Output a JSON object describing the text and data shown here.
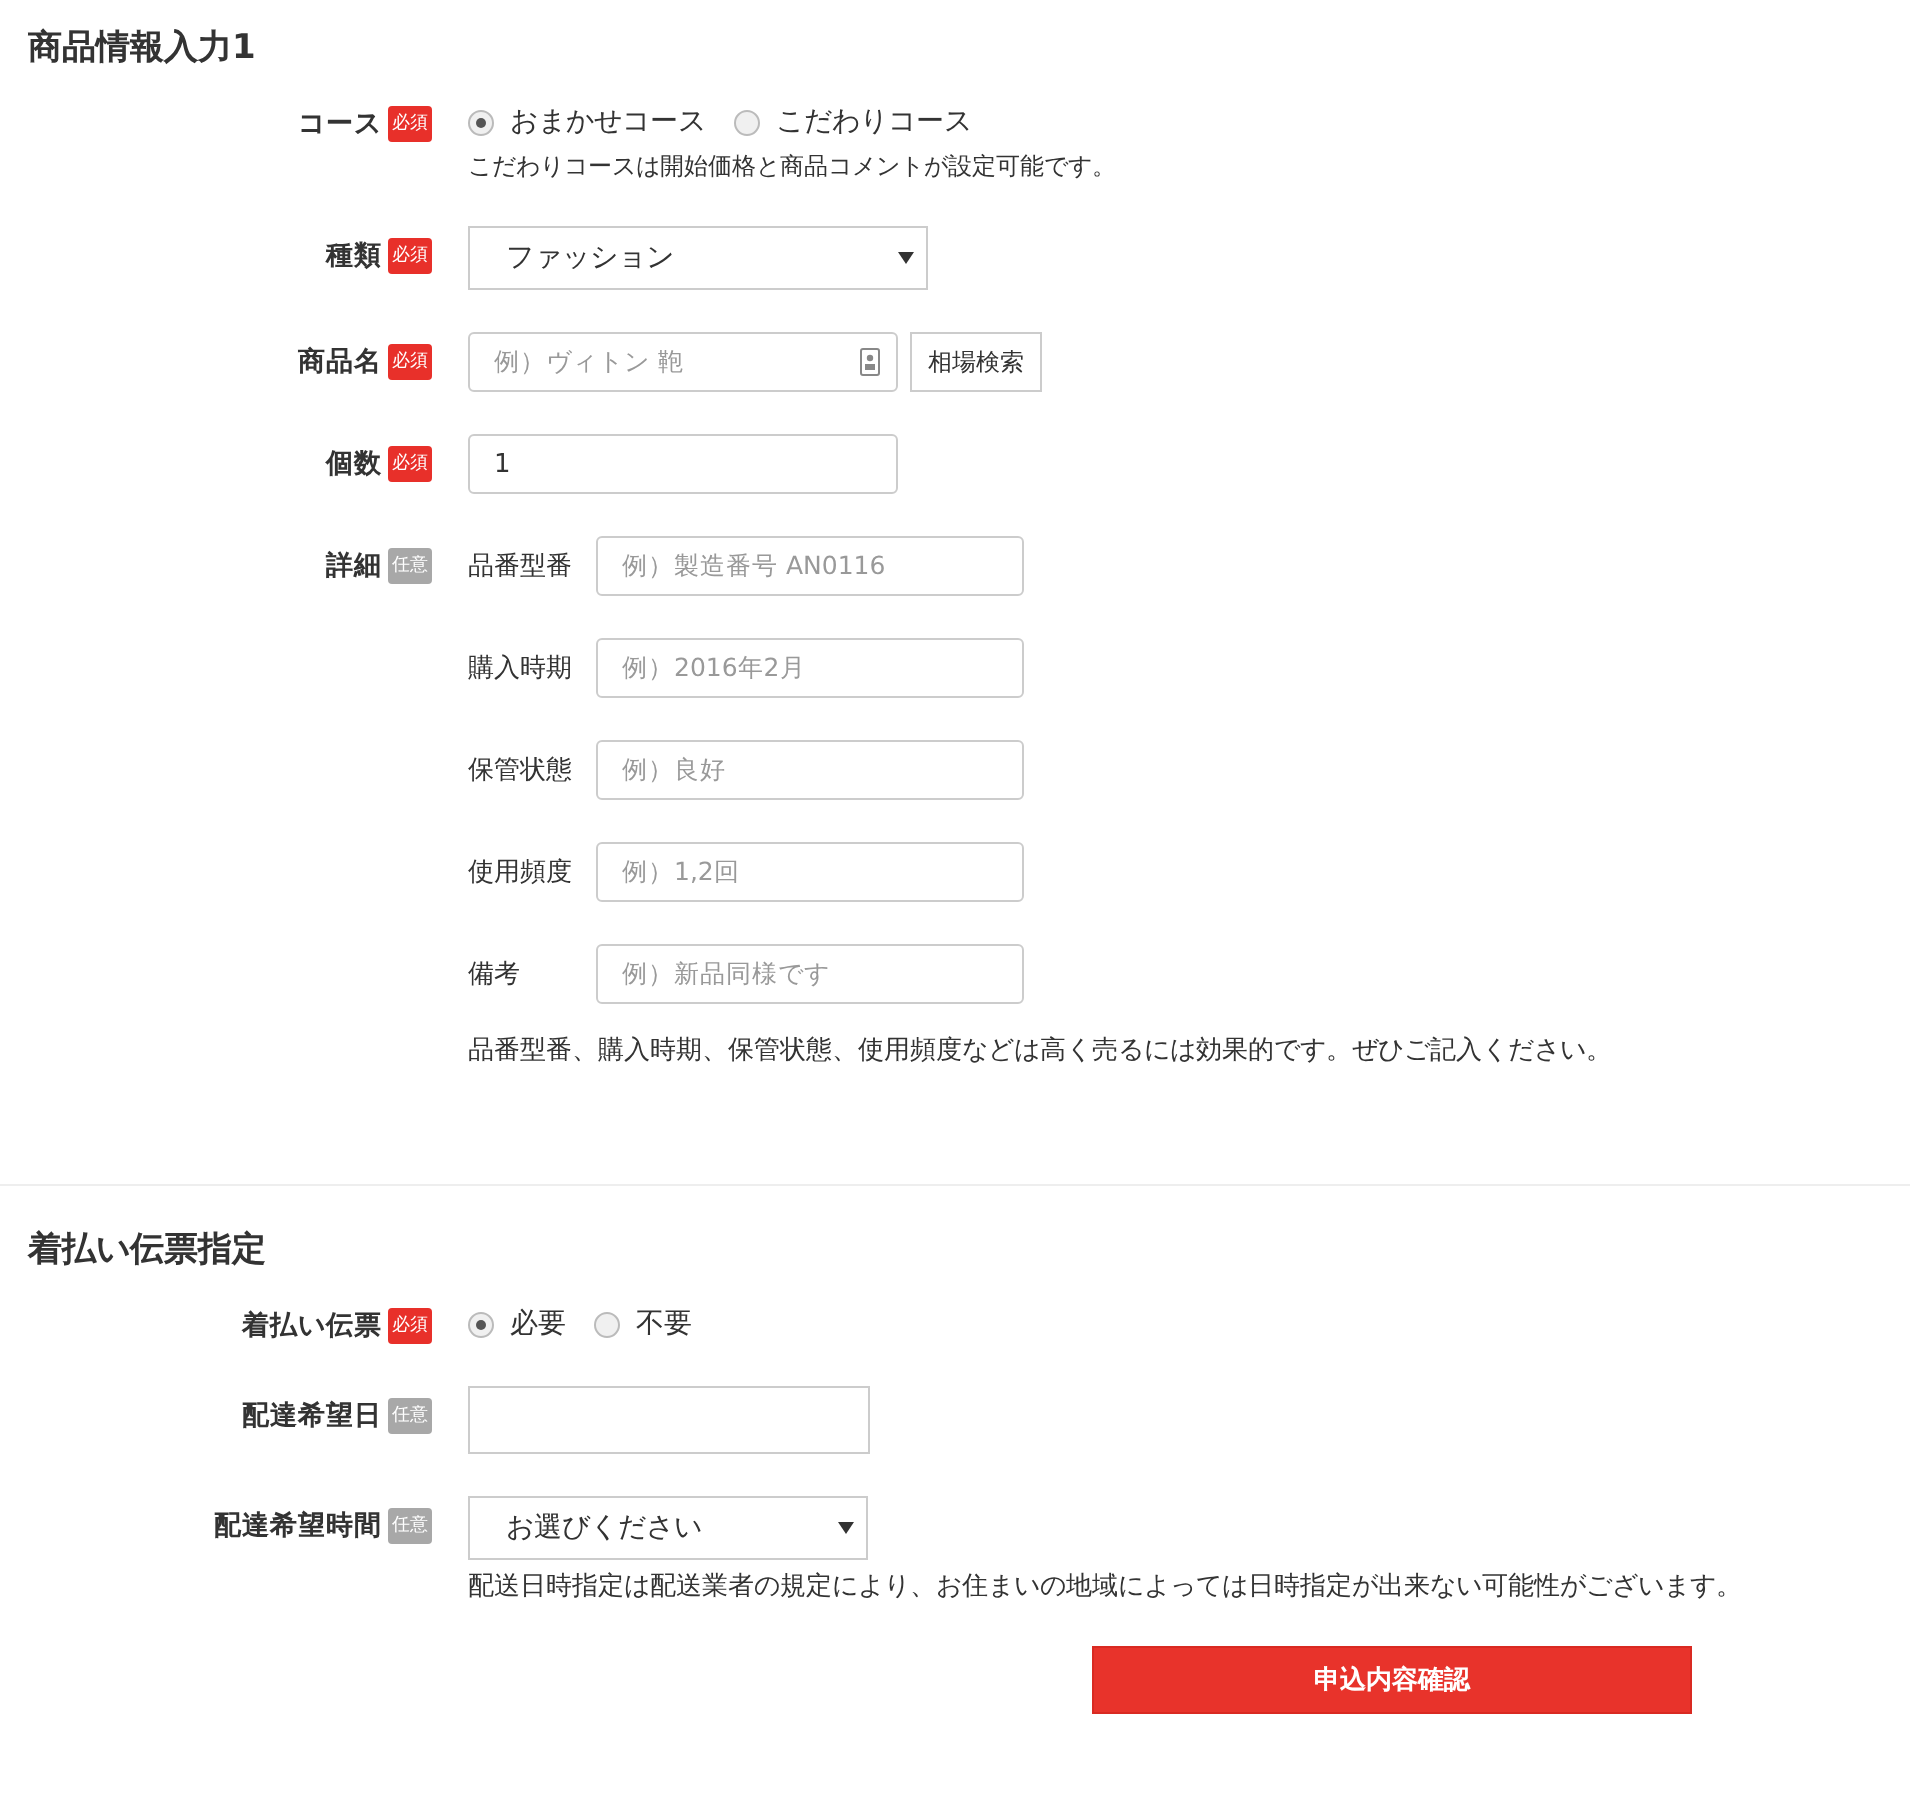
{
  "sections": [
    {
      "title": "商品情報入力1",
      "fields": [
        {
          "label": "コース",
          "required": true,
          "badge": "必須",
          "kind": "radio",
          "options": [
            {
              "label": "おまかせコース",
              "selected": true
            },
            {
              "label": "こだわりコース",
              "selected": false
            }
          ],
          "note": "こだわりコースは開始価格と商品コメントが設定可能です。"
        },
        {
          "label": "種類",
          "required": true,
          "badge": "必須",
          "kind": "select",
          "value": "ファッション"
        },
        {
          "label": "商品名",
          "required": true,
          "badge": "必須",
          "kind": "search",
          "placeholder": "例）ヴィトン 鞄",
          "button": "相場検索"
        },
        {
          "label": "個数",
          "required": true,
          "badge": "必須",
          "kind": "input",
          "value": "1"
        },
        {
          "label": "詳細",
          "required": false,
          "badge": "任意",
          "kind": "details",
          "items": [
            {
              "label": "品番型番",
              "placeholder": "例）製造番号 AN0116"
            },
            {
              "label": "購入時期",
              "placeholder": "例）2016年2月"
            },
            {
              "label": "保管状態",
              "placeholder": "例）良好"
            },
            {
              "label": "使用頻度",
              "placeholder": "例）1,2回"
            },
            {
              "label": "備考",
              "placeholder": "例）新品同様です"
            }
          ],
          "note": "品番型番、購入時期、保管状態、使用頻度などは高く売るには効果的です。ぜひご記入ください。"
        }
      ]
    },
    {
      "title": "着払い伝票指定",
      "fields": [
        {
          "label": "着払い伝票",
          "required": true,
          "badge": "必須",
          "kind": "radio",
          "options": [
            {
              "label": "必要",
              "selected": true
            },
            {
              "label": "不要",
              "selected": false
            }
          ]
        },
        {
          "label": "配達希望日",
          "required": false,
          "badge": "任意",
          "kind": "input"
        },
        {
          "label": "配達希望時間",
          "required": false,
          "badge": "任意",
          "kind": "select",
          "value": "お選びください",
          "note": "配送日時指定は配送業者の規定により、お住まいの地域によっては日時指定が出来ない可能性がございます。"
        }
      ]
    }
  ],
  "submit": "申込内容確認"
}
